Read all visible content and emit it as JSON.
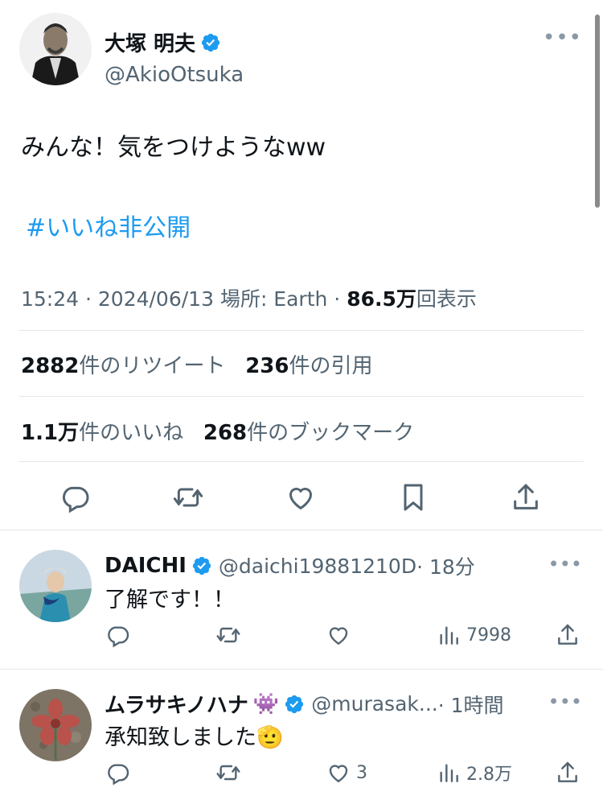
{
  "tweet": {
    "author": {
      "name": "大塚 明夫",
      "handle": "@AkioOtsuka"
    },
    "more_label": "•••",
    "text": "みんな！気をつけようなww",
    "hashtag": "#いいね非公開",
    "meta": {
      "time": "15:24",
      "sep": " · ",
      "date": "2024/06/13",
      "location": "場所: Earth",
      "views_value": "86.5万",
      "views_label": "回表示"
    },
    "stats": {
      "retweets_value": "2882",
      "retweets_label": "件のリツイート",
      "quotes_value": "236",
      "quotes_label": "件の引用",
      "likes_value": "1.1万",
      "likes_label": "件のいいね",
      "bookmarks_value": "268",
      "bookmarks_label": "件のブックマーク"
    }
  },
  "replies": [
    {
      "name": "DAICHI",
      "handle": "@daichi19881210D",
      "time": " · 18分",
      "text": "了解です！！",
      "likes": "",
      "views": "7998"
    },
    {
      "name": "ムラサキノハナ",
      "emoji": "👾",
      "handle": "@murasak...",
      "time": " · 1時間",
      "text": "承知致しました",
      "text_emoji": "🫡",
      "likes": "3",
      "views": "2.8万"
    }
  ],
  "colors": {
    "accent": "#1d9bf0",
    "muted": "#536471",
    "text": "#0f1419",
    "divider": "#e5e7ea"
  }
}
